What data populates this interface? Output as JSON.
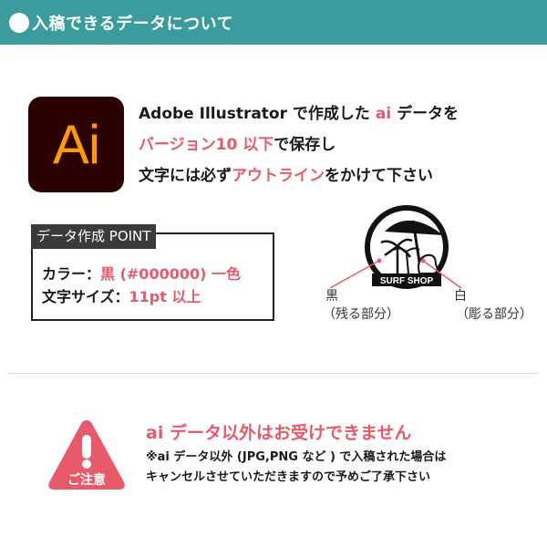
{
  "header": {
    "title": "入稿できるデータについて"
  },
  "logo": {
    "text": "Ai"
  },
  "intro": {
    "line1_a": "Adobe Illustrator で作成した ",
    "line1_hl": "ai",
    "line1_b": " データを",
    "line2_hl": "バージョン10 以下",
    "line2_b": "で保存し",
    "line3_a": "文字には必ず",
    "line3_hl": "アウトライン",
    "line3_b": "をかけて下さい"
  },
  "point": {
    "tag": "データ作成 POINT",
    "color_label": "カラー：",
    "color_value": "黒 (#000000) 一色",
    "size_label": "文字サイズ：",
    "size_value": "11pt 以上"
  },
  "sample": {
    "logo_text": "SURF SHOP",
    "black_label": "黒",
    "black_sub": "（残る部分）",
    "white_label": "白",
    "white_sub": "（彫る部分）"
  },
  "notice": {
    "badge": "ご注意",
    "title": "ai データ以外はお受けできません",
    "body_line1": "※ai データ以外 (JPG,PNG など ) で入稿された場合は",
    "body_line2": "キャンセルさせていただきますので予めご了承下さい"
  },
  "colors": {
    "header_bg": "#3a9c9c",
    "accent": "#e85a6a",
    "logo_bg": "#2b0100",
    "logo_fg": "#ff9a00"
  }
}
